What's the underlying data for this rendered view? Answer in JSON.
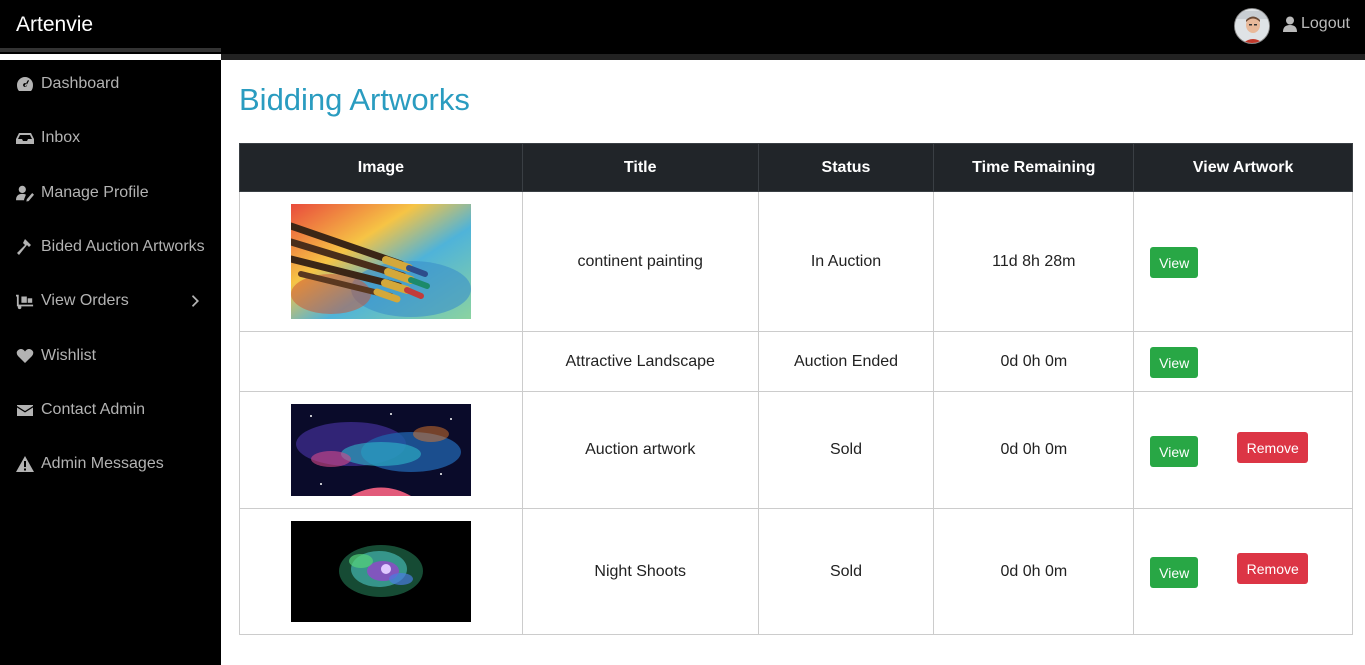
{
  "app": {
    "brand": "Artenvie"
  },
  "header": {
    "logout_label": "Logout",
    "avatar": "user-avatar"
  },
  "sidebar": {
    "items": [
      {
        "label": "Dashboard",
        "icon": "dashboard-icon"
      },
      {
        "label": "Inbox",
        "icon": "inbox-icon"
      },
      {
        "label": "Manage Profile",
        "icon": "user-edit-icon"
      },
      {
        "label": "Bided Auction Artworks",
        "icon": "gavel-icon"
      },
      {
        "label": "View Orders",
        "icon": "dolly-icon",
        "has_submenu": true
      },
      {
        "label": "Wishlist",
        "icon": "heart-icon"
      },
      {
        "label": "Contact Admin",
        "icon": "envelope-icon"
      },
      {
        "label": "Admin Messages",
        "icon": "warning-icon"
      }
    ]
  },
  "main": {
    "title": "Bidding Artworks",
    "table": {
      "headers": [
        "Image",
        "Title",
        "Status",
        "Time Remaining",
        "View Artwork"
      ],
      "rows": [
        {
          "image": "paint-brushes-image",
          "title": "continent painting",
          "status": "In Auction",
          "time_remaining": "11d 8h 28m",
          "view_label": "View",
          "remove_label": null
        },
        {
          "image": null,
          "title": "Attractive Landscape",
          "status": "Auction Ended",
          "time_remaining": "0d 0h 0m",
          "view_label": "View",
          "remove_label": null
        },
        {
          "image": "galaxy-nebula-image",
          "title": "Auction artwork",
          "status": "Sold",
          "time_remaining": "0d 0h 0m",
          "view_label": "View",
          "remove_label": "Remove"
        },
        {
          "image": "color-powder-explosion-image",
          "title": "Night Shoots",
          "status": "Sold",
          "time_remaining": "0d 0h 0m",
          "view_label": "View",
          "remove_label": "Remove"
        }
      ]
    }
  },
  "colors": {
    "title": "#2a9cc0",
    "table_header_bg": "#212529",
    "view_button": "#28a745",
    "remove_button": "#dc3545",
    "sidebar_bg": "#000000"
  }
}
